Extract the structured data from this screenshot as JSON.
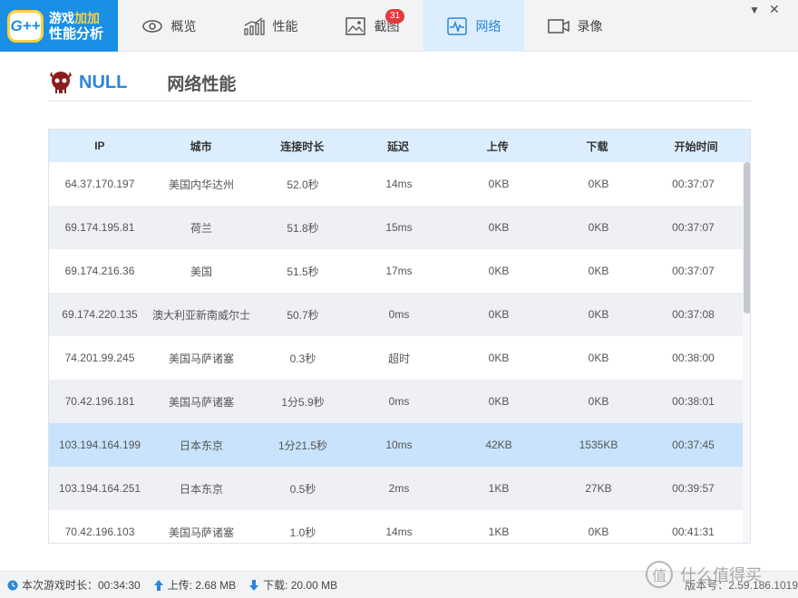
{
  "app": {
    "logo_badge": "G++",
    "logo_line1a": "游戏",
    "logo_line1b": "加加",
    "logo_line2": "性能分析"
  },
  "tabs": [
    {
      "label": "概览",
      "icon": "eye-icon"
    },
    {
      "label": "性能",
      "icon": "bar-chart-icon"
    },
    {
      "label": "截图",
      "icon": "image-icon",
      "badge": "31"
    },
    {
      "label": "网络",
      "icon": "pulse-icon",
      "active": true
    },
    {
      "label": "录像",
      "icon": "video-icon"
    }
  ],
  "window": {
    "minimize": "▼",
    "close": "✕"
  },
  "header": {
    "game_name": "NULL",
    "section_title": "网络性能"
  },
  "table": {
    "columns": [
      "IP",
      "城市",
      "连接时长",
      "延迟",
      "上传",
      "下载",
      "开始时间"
    ],
    "rows": [
      [
        "64.37.170.197",
        "美国内华达州",
        "52.0秒",
        "14ms",
        "0KB",
        "0KB",
        "00:37:07"
      ],
      [
        "69.174.195.81",
        "荷兰",
        "51.8秒",
        "15ms",
        "0KB",
        "0KB",
        "00:37:07"
      ],
      [
        "69.174.216.36",
        "美国",
        "51.5秒",
        "17ms",
        "0KB",
        "0KB",
        "00:37:07"
      ],
      [
        "69.174.220.135",
        "澳大利亚新南威尔士",
        "50.7秒",
        "0ms",
        "0KB",
        "0KB",
        "00:37:08"
      ],
      [
        "74.201.99.245",
        "美国马萨诸塞",
        "0.3秒",
        "超时",
        "0KB",
        "0KB",
        "00:38:00"
      ],
      [
        "70.42.196.181",
        "美国马萨诸塞",
        "1分5.9秒",
        "0ms",
        "0KB",
        "0KB",
        "00:38:01"
      ],
      [
        "103.194.164.199",
        "日本东京",
        "1分21.5秒",
        "10ms",
        "42KB",
        "1535KB",
        "00:37:45"
      ],
      [
        "103.194.164.251",
        "日本东京",
        "0.5秒",
        "2ms",
        "1KB",
        "27KB",
        "00:39:57"
      ],
      [
        "70.42.196.103",
        "美国马萨诸塞",
        "1.0秒",
        "14ms",
        "1KB",
        "0KB",
        "00:41:31"
      ]
    ],
    "selected_row": 6
  },
  "status": {
    "session_label": "本次游戏时长：00:34:30",
    "upload_label": "上传: 2.68 MB",
    "download_label": "下载: 20.00 MB",
    "version_label": "版本号：2.59.186.1019"
  },
  "watermark": {
    "glyph": "值",
    "text": "什么值得买"
  },
  "colors": {
    "accent": "#2b86d6",
    "header_bg": "#dceefe",
    "selected_row": "#c8e3fb",
    "badge": "#e23b3b"
  }
}
